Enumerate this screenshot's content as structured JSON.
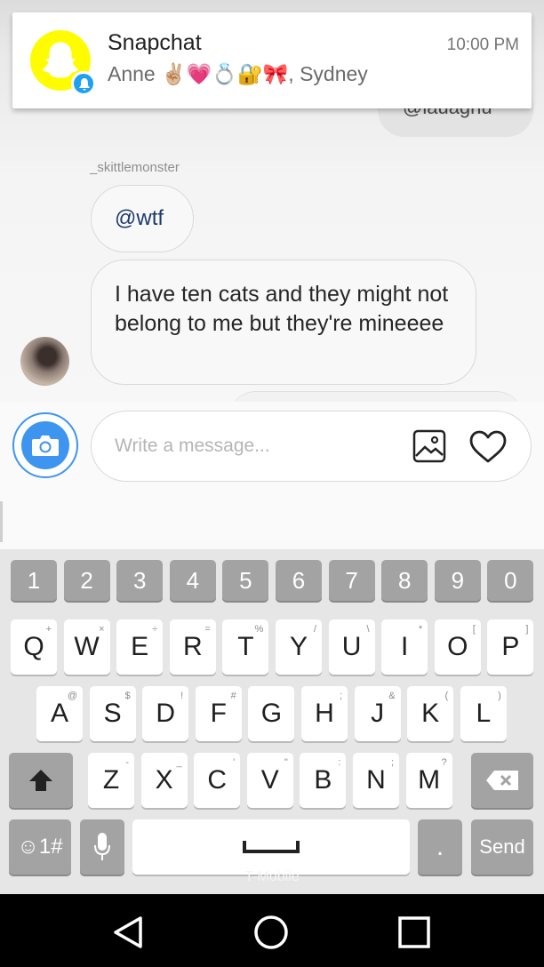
{
  "notification": {
    "app": "Snapchat",
    "time": "10:00 PM",
    "text": "Anne ✌🏼💗💍🔐🎀, Sydney"
  },
  "chat": {
    "previous_partial": "@lauagnu",
    "sender": "_skittlemonster",
    "messages": [
      {
        "text": "@wtf"
      },
      {
        "text": "I have ten cats and they might not belong to me but they're mineeee"
      }
    ]
  },
  "composer": {
    "placeholder": "Write a message..."
  },
  "keyboard": {
    "number_row": [
      "1",
      "2",
      "3",
      "4",
      "5",
      "6",
      "7",
      "8",
      "9",
      "0"
    ],
    "row1": [
      {
        "k": "Q",
        "s": "+"
      },
      {
        "k": "W",
        "s": "×"
      },
      {
        "k": "E",
        "s": "÷"
      },
      {
        "k": "R",
        "s": "="
      },
      {
        "k": "T",
        "s": "%"
      },
      {
        "k": "Y",
        "s": "/"
      },
      {
        "k": "U",
        "s": "\\"
      },
      {
        "k": "I",
        "s": "*"
      },
      {
        "k": "O",
        "s": "["
      },
      {
        "k": "P",
        "s": "]"
      }
    ],
    "row2": [
      {
        "k": "A",
        "s": "@"
      },
      {
        "k": "S",
        "s": "$"
      },
      {
        "k": "D",
        "s": "!"
      },
      {
        "k": "F",
        "s": "#"
      },
      {
        "k": "G",
        "s": ""
      },
      {
        "k": "H",
        "s": ";"
      },
      {
        "k": "J",
        "s": "&"
      },
      {
        "k": "K",
        "s": "("
      },
      {
        "k": "L",
        "s": ")"
      }
    ],
    "row3": [
      {
        "k": "Z",
        "s": "-"
      },
      {
        "k": "X",
        "s": "_"
      },
      {
        "k": "C",
        "s": "'"
      },
      {
        "k": "V",
        "s": "\""
      },
      {
        "k": "B",
        "s": ":"
      },
      {
        "k": "N",
        "s": ";"
      },
      {
        "k": "M",
        "s": "?"
      }
    ],
    "symbols_key": "☺1#",
    "period_key": ".",
    "send_key": "Send",
    "carrier": "T-Mobile"
  },
  "colors": {
    "accent": "#3d95ef",
    "snapchat_yellow": "#fffc00"
  }
}
